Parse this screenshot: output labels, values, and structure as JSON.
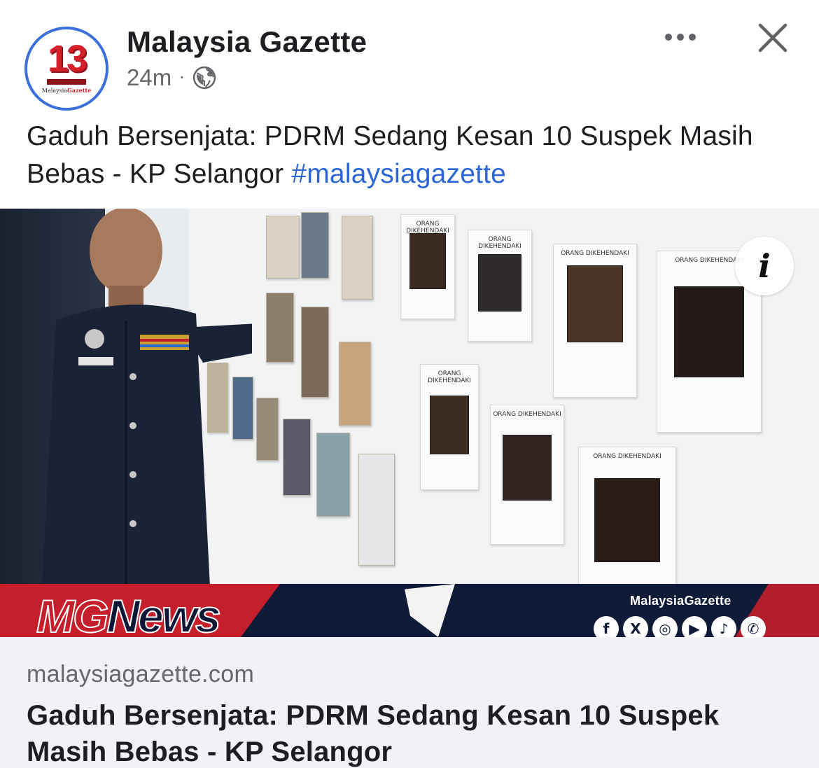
{
  "header": {
    "avatar": {
      "number": "13",
      "brand_prefix": "Malaysia",
      "brand_suffix": "Gazette"
    },
    "page_name": "Malaysia Gazette",
    "timestamp": "24m",
    "separator": "·",
    "privacy_icon": "globe-icon",
    "more_icon": "more-horizontal-icon",
    "close_icon": "close-icon"
  },
  "post": {
    "text": "Gaduh Bersenjata: PDRM Sedang Kesan 10 Suspek Masih Bebas - KP Selangor",
    "hashtag": "#malaysiagazette"
  },
  "image": {
    "info_icon": "info-icon",
    "info_glyph": "i",
    "wanted_caption": "ORANG DIKEHENDAKI",
    "banner": {
      "logo_mg": "MG",
      "logo_news": "News",
      "brand": "MalaysiaGazette",
      "socials": [
        {
          "icon": "facebook-icon",
          "glyph": "f"
        },
        {
          "icon": "x-icon",
          "glyph": "X"
        },
        {
          "icon": "instagram-icon",
          "glyph": "◎"
        },
        {
          "icon": "youtube-icon",
          "glyph": "▶"
        },
        {
          "icon": "tiktok-icon",
          "glyph": "♪"
        },
        {
          "icon": "whatsapp-icon",
          "glyph": "✆"
        }
      ]
    }
  },
  "link_preview": {
    "domain": "malaysiagazette.com",
    "title": "Gaduh Bersenjata: PDRM Sedang Kesan 10 Suspek Masih Bebas - KP Selangor"
  },
  "colors": {
    "accent_blue": "#2a66d4",
    "avatar_ring": "#3b6fd9",
    "brand_red": "#c41f2b",
    "banner_navy": "#101b38",
    "link_bg": "#f0f2f5",
    "muted_text": "#65676b"
  }
}
